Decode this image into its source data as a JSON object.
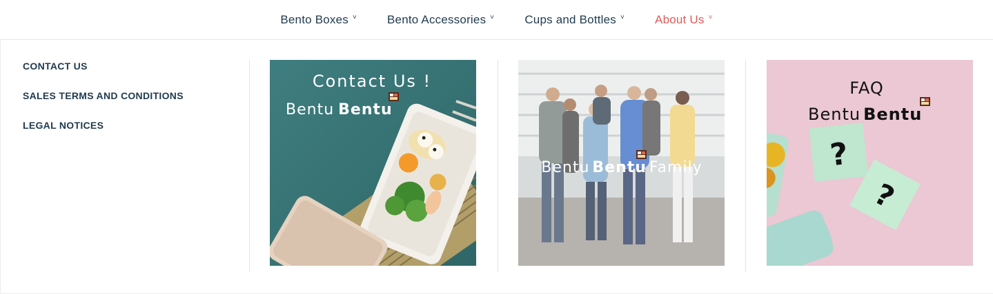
{
  "nav": {
    "items": [
      {
        "label": "Bento Boxes"
      },
      {
        "label": "Bento Accessories"
      },
      {
        "label": "Cups and Bottles"
      },
      {
        "label": "About Us"
      }
    ],
    "chevron": "˅",
    "active_color": "#e05a5a"
  },
  "menu": {
    "links": [
      {
        "label": "CONTACT US"
      },
      {
        "label": "SALES TERMS AND CONDITIONS"
      },
      {
        "label": "LEGAL NOTICES"
      }
    ]
  },
  "cards": {
    "contact": {
      "title": "Contact  Us !",
      "brand_light": "Bentu",
      "brand_bold": "Bentu"
    },
    "family": {
      "brand_light": "Bentu",
      "brand_bold": "Bentu",
      "suffix": "Family"
    },
    "faq": {
      "title": "FAQ",
      "brand_light": "Bentu",
      "brand_bold": "Bentu",
      "mark1": "?",
      "mark2": "?"
    }
  },
  "colors": {
    "text": "#1f3a4d",
    "accent": "#e05a5a",
    "teal": "#4a8585",
    "pink": "#eac9d3",
    "mint": "#bfe6cf"
  }
}
